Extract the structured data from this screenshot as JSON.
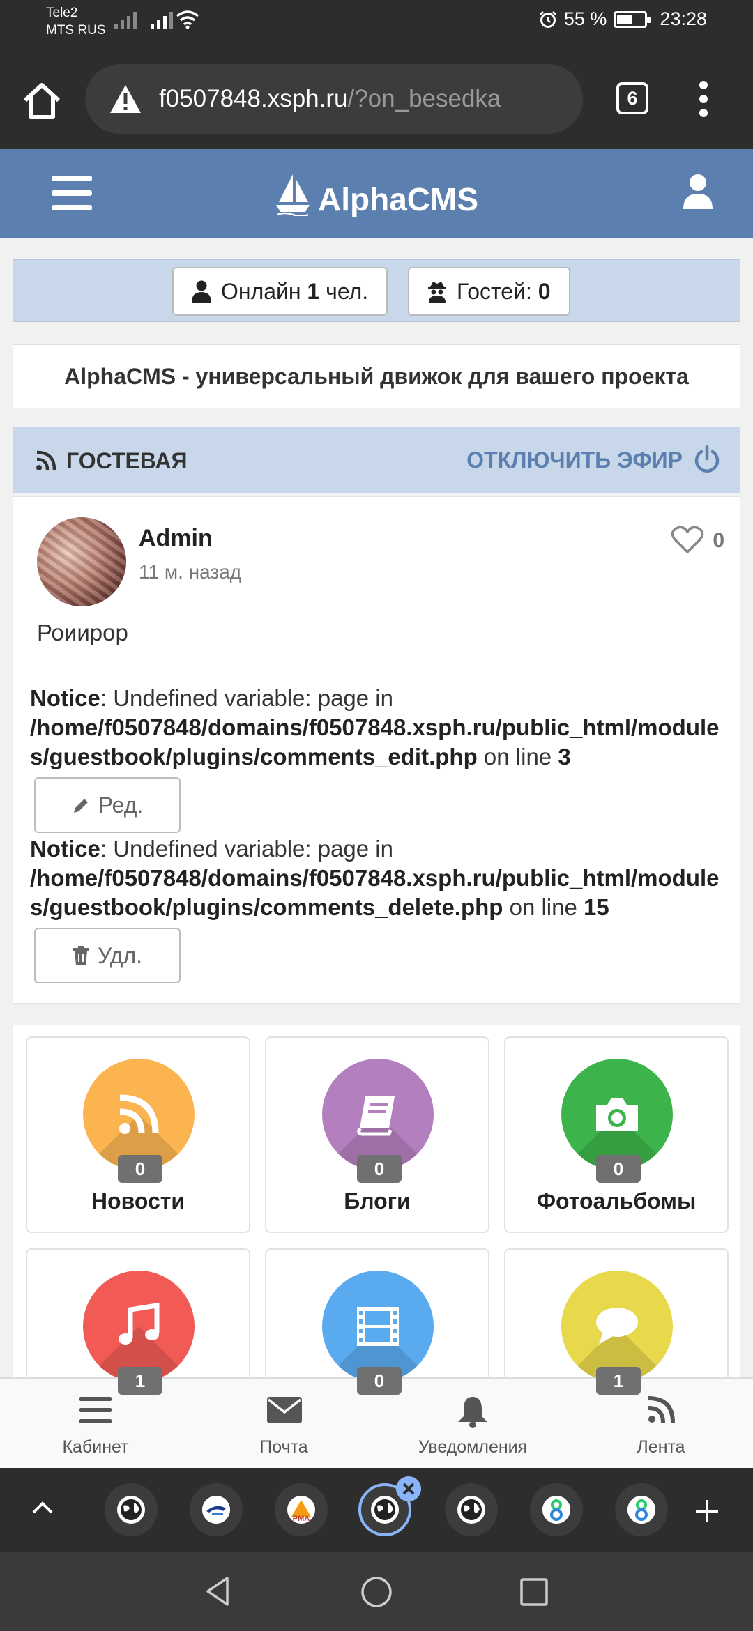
{
  "status_bar": {
    "carrier1": "Tele2",
    "carrier2": "MTS RUS",
    "battery": "55 %",
    "battery_level": 0.55,
    "time": "23:28"
  },
  "browser": {
    "url_host": "f0507848.xsph.ru",
    "url_rest": "/?on_besedka",
    "tab_count": "6"
  },
  "site": {
    "name": "AlphaCMS",
    "online_label": "Онлайн",
    "online_count": "1",
    "online_unit": "чел.",
    "guests_label": "Гостей:",
    "guests_count": "0",
    "slogan": "AlphaCMS - универсальный движок для вашего проекта"
  },
  "guestbook": {
    "title": "ГОСТЕВАЯ",
    "toggle": "ОТКЛЮЧИТЬ ЭФИР"
  },
  "post": {
    "author": "Admin",
    "time": "11 м. назад",
    "likes": "0",
    "text": "Роиирор",
    "notice1": {
      "label": "Notice",
      "message": ": Undefined variable: page in",
      "path": "/home/f0507848/domains/f0507848.xsph.ru/public_html/modules/guestbook/plugins/comments_edit.php",
      "line_text": " on line ",
      "line": "3"
    },
    "edit_button": "Ред.",
    "notice2": {
      "label": "Notice",
      "message": ": Undefined variable: page in",
      "path": "/home/f0507848/domains/f0507848.xsph.ru/public_html/modules/guestbook/plugins/comments_delete.php",
      "line_text": " on line ",
      "line": "15"
    },
    "delete_button": "Удл."
  },
  "tiles": [
    {
      "label": "Новости",
      "count": "0",
      "color": "#fbb450",
      "icon": "rss-icon"
    },
    {
      "label": "Блоги",
      "count": "0",
      "color": "#b47fbf",
      "icon": "book-icon"
    },
    {
      "label": "Фотоальбомы",
      "count": "0",
      "color": "#3cb44b",
      "icon": "camera-icon"
    },
    {
      "label": "",
      "count": "1",
      "color": "#f15a55",
      "icon": "music-icon"
    },
    {
      "label": "",
      "count": "0",
      "color": "#5aaaf0",
      "icon": "film-icon"
    },
    {
      "label": "",
      "count": "1",
      "color": "#e8d84c",
      "icon": "chat-icon"
    }
  ],
  "bottom_nav": {
    "cabinet": "Кабинет",
    "mail": "Почта",
    "notifications": "Уведомления",
    "feed": "Лента"
  },
  "tab_strip": {
    "tab_labels": [
      "PMA"
    ]
  }
}
